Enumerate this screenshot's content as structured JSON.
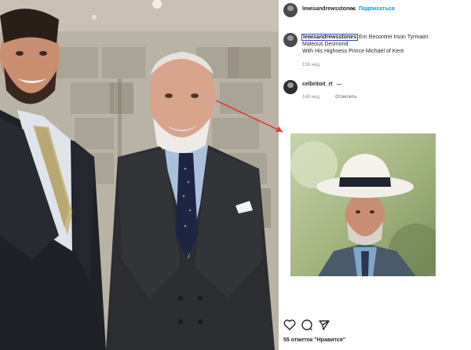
{
  "photo": {
    "description_icon": "photo-two-men"
  },
  "post": {
    "username": "lewisandrewsstones",
    "dot": "•",
    "follow_label": "Подписаться",
    "caption_mention": "lewisandrewsstones",
    "caption_line1": " Em Recontrei Irson Tyrmaim",
    "caption_line2": "Maleous Desmond",
    "caption_line3": "With His Highness Prince Michael of Kent",
    "caption_time": "158 нед.",
    "comment_user": "celbritoit_rt",
    "comment_text": "ꟷ",
    "comment_time": "148 нед.",
    "comment_reply": "Ответить",
    "likes": "55 отметок \"Нравится\""
  },
  "icons": {
    "like": "heart-icon",
    "comment": "comment-icon",
    "share": "share-icon"
  },
  "colors": {
    "accent": "#0095f6",
    "arrow": "#e23b3b",
    "mention_box": "#2d4fb5"
  }
}
